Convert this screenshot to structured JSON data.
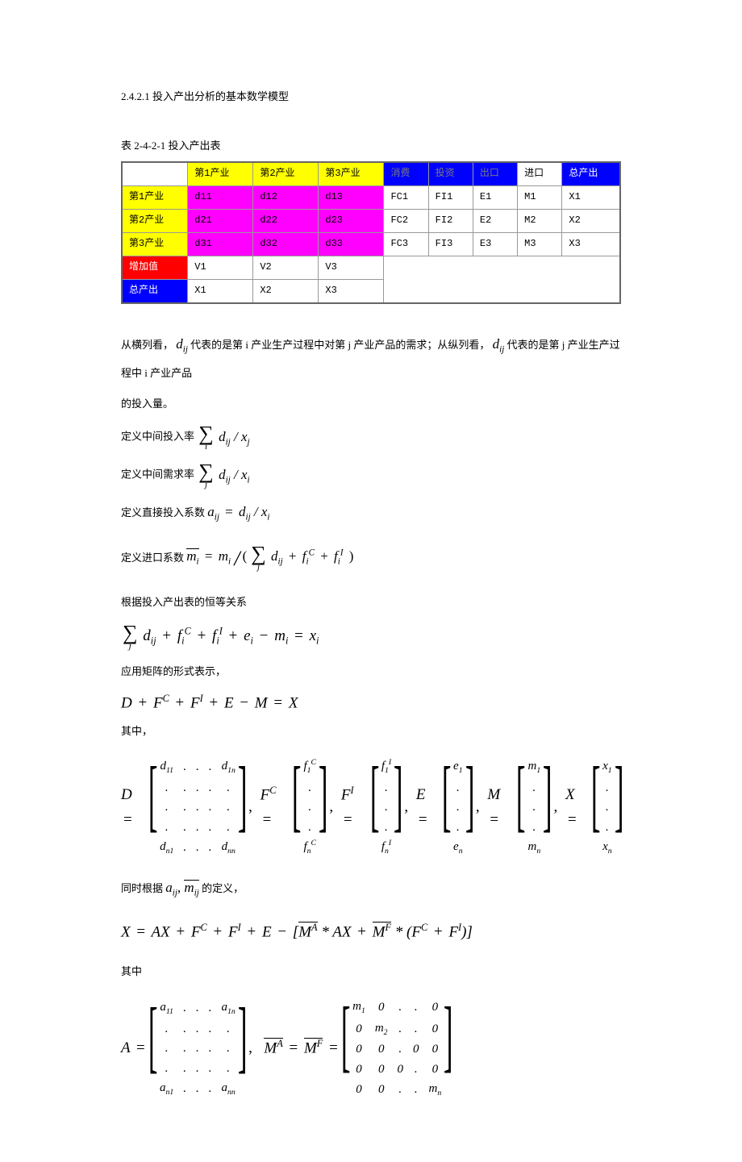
{
  "heading": "2.4.2.1 投入产出分析的基本数学模型",
  "table_caption": "表 2-4-2-1 投入产出表",
  "table": {
    "header": [
      "",
      "第1产业",
      "第2产业",
      "第3产业",
      "消费",
      "投资",
      "出口",
      "进口",
      "总产出"
    ],
    "rows": [
      {
        "label": "第1产业",
        "cells": [
          "d11",
          "d12",
          "d13",
          "FC1",
          "FI1",
          "E1",
          "M1",
          "X1"
        ]
      },
      {
        "label": "第2产业",
        "cells": [
          "d21",
          "d22",
          "d23",
          "FC2",
          "FI2",
          "E2",
          "M2",
          "X2"
        ]
      },
      {
        "label": "第3产业",
        "cells": [
          "d31",
          "d32",
          "d33",
          "FC3",
          "FI3",
          "E3",
          "M3",
          "X3"
        ]
      },
      {
        "label": "增加值",
        "cells": [
          "V1",
          "V2",
          "V3"
        ]
      },
      {
        "label": "总产出",
        "cells": [
          "X1",
          "X2",
          "X3"
        ]
      }
    ]
  },
  "text": {
    "p1a": "从横列看，",
    "p1b": " 代表的是第 i 产业生产过程中对第 j 产业产品的需求；从纵列看，",
    "p1c": " 代表的是第 j 产业生产过程中 i 产业产品",
    "p1d": "的投入量。",
    "def1": "定义中间投入率",
    "def2": "定义中间需求率",
    "def3": "定义直接投入系数",
    "def4": "定义进口系数",
    "p2": "根据投入产出表的恒等关系",
    "p3": "应用矩阵的形式表示，",
    "p4": "其中，",
    "p5a": "同时根据",
    "p5b": " 的定义，",
    "p6": "其中"
  },
  "math": {
    "dij": "d",
    "dij_sub": "ij",
    "sum_i": "i",
    "sum_j": "j",
    "inputrate": "d_{ij} / x_j",
    "demandrate": "d_{ij} / x_i",
    "aij_eq": "a_{ij} = d_{ij} / x_i",
    "mbar_eq_lhs": "m_i",
    "mbar_eq_rhs": "= m_i / ( Σ_j d_{ij} + f_i^C + f_i^I )",
    "identity": "Σ_j d_{ij} + f_i^C + f_i^I + e_i − m_i = x_i",
    "matrix_eq": "D + F^C + F^I + E − M = X",
    "x_eq": "X = AX + F^C + F^I + E − [ M^A * AX + M^F * (F^C + F^I) ]",
    "aij_mij": "a_{ij}, m̄_{ij}"
  },
  "matrices": {
    "D": {
      "label": "D =",
      "rows": [
        [
          "d",
          "11",
          ".",
          ".",
          ".",
          "d",
          "1n"
        ],
        [
          ".",
          "",
          ".",
          ".",
          ".",
          ".",
          ""
        ],
        [
          ".",
          "",
          ".",
          ".",
          ".",
          ".",
          ""
        ],
        [
          ".",
          "",
          ".",
          ".",
          ".",
          ".",
          ""
        ],
        [
          "d",
          "n1",
          ".",
          ".",
          ".",
          "d",
          "nn"
        ]
      ]
    },
    "FC": {
      "label": "F^C =",
      "rows": [
        [
          "f_1^C"
        ],
        [
          "."
        ],
        [
          "."
        ],
        [
          "."
        ],
        [
          "f_n^C"
        ]
      ]
    },
    "FI": {
      "label": "F^I =",
      "rows": [
        [
          "f_1^I"
        ],
        [
          "."
        ],
        [
          "."
        ],
        [
          "."
        ],
        [
          "f_n^I"
        ]
      ]
    },
    "E": {
      "label": "E =",
      "rows": [
        [
          "e_1"
        ],
        [
          "."
        ],
        [
          "."
        ],
        [
          "."
        ],
        [
          "e_n"
        ]
      ]
    },
    "M": {
      "label": "M =",
      "rows": [
        [
          "m_1"
        ],
        [
          "."
        ],
        [
          "."
        ],
        [
          "."
        ],
        [
          "m_n"
        ]
      ]
    },
    "X": {
      "label": "X =",
      "rows": [
        [
          "x_1"
        ],
        [
          "."
        ],
        [
          "."
        ],
        [
          "."
        ],
        [
          "x_n"
        ]
      ]
    },
    "A": {
      "label": "A =",
      "rows": [
        [
          "a_11",
          ".",
          ".",
          ".",
          "a_1n"
        ],
        [
          ".",
          ".",
          ".",
          ".",
          "."
        ],
        [
          ".",
          ".",
          ".",
          ".",
          "."
        ],
        [
          ".",
          ".",
          ".",
          ".",
          "."
        ],
        [
          "a_n1",
          ".",
          ".",
          ".",
          "a_nn"
        ]
      ]
    },
    "MA_MF": {
      "label": "M^A = M^F =",
      "rows": [
        [
          "m_1",
          "0",
          ".",
          ".",
          "0"
        ],
        [
          "0",
          "m_2",
          ".",
          ".",
          "0"
        ],
        [
          "0",
          "0",
          ".",
          "0",
          "0"
        ],
        [
          "0",
          "0",
          "0",
          ".",
          "0"
        ],
        [
          "0",
          "0",
          ".",
          ".",
          "m_n"
        ]
      ]
    }
  }
}
